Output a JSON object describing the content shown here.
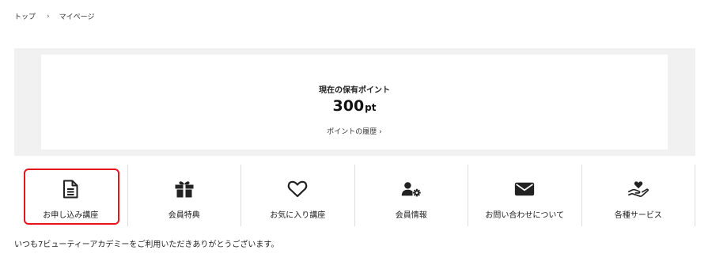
{
  "breadcrumb": {
    "home": "トップ",
    "separator": "›",
    "current": "マイページ"
  },
  "points": {
    "label": "現在の保有ポイント",
    "value": "300",
    "unit": "pt",
    "history_link": "ポイントの履歴 ›"
  },
  "menu": {
    "items": [
      {
        "label": "お申し込み講座",
        "icon": "document-icon",
        "selected": true
      },
      {
        "label": "会員特典",
        "icon": "gift-icon"
      },
      {
        "label": "お気に入り講座",
        "icon": "heart-icon"
      },
      {
        "label": "会員情報",
        "icon": "user-cog-icon"
      },
      {
        "label": "お問い合わせについて",
        "icon": "envelope-icon"
      },
      {
        "label": "各種サービス",
        "icon": "hand-heart-icon"
      }
    ],
    "highlight_color": "#e8141c"
  },
  "welcome_text": "いつも7ビューティーアカデミーをご利用いただきありがとうございます。"
}
